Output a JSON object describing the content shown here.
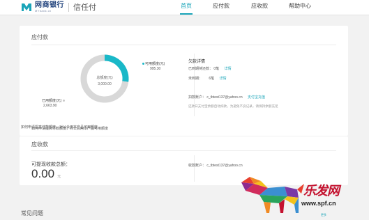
{
  "header": {
    "bank_name": "网商银行",
    "bank_name_en": "MYbank.cn",
    "product": "信任付",
    "nav": [
      "首页",
      "应付款",
      "应收款",
      "帮助中心"
    ],
    "active_nav": 0,
    "accent_color": "#1aa5b9"
  },
  "payable": {
    "title": "应付款",
    "chart_data": {
      "type": "pie",
      "categories": [
        "可用额度(元)",
        "已用额度(元)"
      ],
      "values": [
        995.3,
        2663.9
      ],
      "value_labels": [
        "995.30",
        "2,663.90"
      ],
      "colors": [
        "#1ab8c8",
        "#d8d8d8"
      ],
      "center_label": "总额度(元)",
      "center_value": "3,000.00"
    },
    "available_label": "可用额度(元)",
    "available_value": "995.30",
    "used_label": "已用额度(元)",
    "used_value": "2,663.90",
    "center_label": "总额度(元)",
    "center_value": "3,000.00",
    "note": "如何申请提高付款额度，对公会用本产品可用额度",
    "details": {
      "title": "欠款详情",
      "overdue_label": "已到期待还款：",
      "overdue_count": "0笔",
      "overdue_link": "详情",
      "notdue_label": "未到期：",
      "notdue_count": "6笔",
      "notdue_link": "详情",
      "deduct_label": "扣款账户：",
      "deduct_account": "c_tbtest137@yahoo.cn",
      "deduct_link": "支付宝充值",
      "deduct_note": "还款日支付宝余额自动扣款，为避免不良记录，请保持余额充足"
    }
  },
  "receivable": {
    "title": "应收款",
    "withdraw_label": "可提现收款总额：",
    "amount": "0.00",
    "unit": "元",
    "account_label": "收款账户：",
    "account": "c_tbtest137@yahoo.cn"
  },
  "faq": {
    "title": "常见问题",
    "more": "更多"
  },
  "watermark": {
    "text": "乐发网",
    "url": "www.spf.cn"
  }
}
